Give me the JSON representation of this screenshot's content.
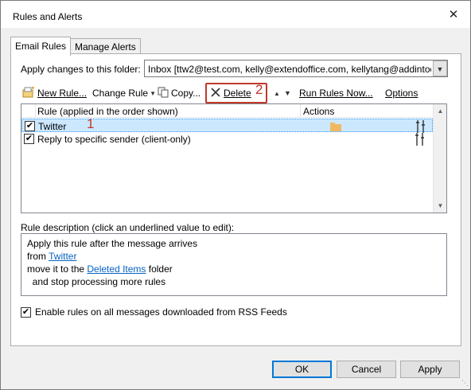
{
  "window": {
    "title": "Rules and Alerts",
    "close_glyph": "✕"
  },
  "tabs": [
    {
      "label": "Email Rules",
      "active": true
    },
    {
      "label": "Manage Alerts",
      "active": false
    }
  ],
  "folder": {
    "label": "Apply changes to this folder:",
    "value": "Inbox [ttw2@test.com, kelly@extendoffice.com, kellytang@addintool"
  },
  "toolbar": {
    "new_rule": "New Rule...",
    "change_rule": "Change Rule",
    "copy": "Copy...",
    "delete": "Delete",
    "run_rules": "Run Rules Now...",
    "options": "Options",
    "move_up_glyph": "▲",
    "move_down_glyph": "▼"
  },
  "annotations": {
    "step1": "1",
    "step2": "2"
  },
  "rules_table": {
    "col_rule": "Rule (applied in the order shown)",
    "col_actions": "Actions",
    "rows": [
      {
        "name": "Twitter",
        "checked": true,
        "selected": true
      },
      {
        "name": "Reply to specific sender  (client-only)",
        "checked": true,
        "selected": false
      }
    ]
  },
  "description": {
    "label": "Rule description (click an underlined value to edit):",
    "line1": "Apply this rule after the message arrives",
    "line2_prefix": "from ",
    "line2_link": "Twitter",
    "line3_prefix": "move it to the ",
    "line3_link": "Deleted Items",
    "line3_suffix": " folder",
    "line4": "  and stop processing more rules"
  },
  "rss": {
    "label": "Enable rules on all messages downloaded from RSS Feeds",
    "checked": true
  },
  "buttons": {
    "ok": "OK",
    "cancel": "Cancel",
    "apply": "Apply"
  },
  "colors": {
    "selection": "#cce8ff",
    "annotation": "#c0392b",
    "default_button": "#0078d7",
    "link": "#0563c1"
  }
}
